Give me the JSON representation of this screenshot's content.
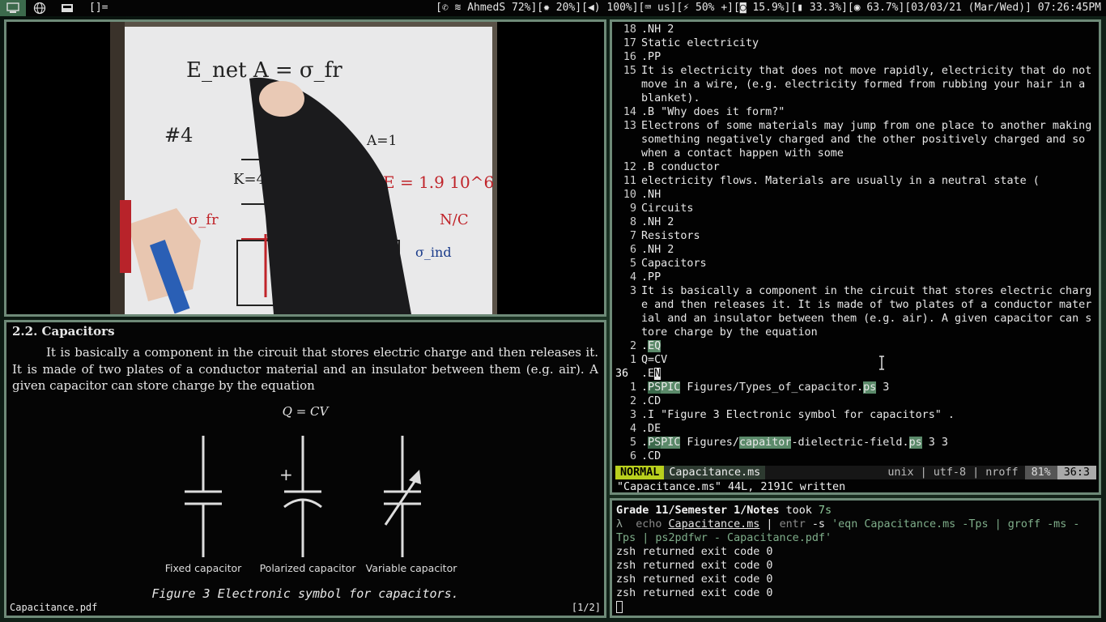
{
  "topbar": {
    "layout_symbol": "[]=",
    "status": {
      "wifi_name": "AhmedS",
      "wifi_strength": "72%",
      "brightness": "20%",
      "volume": "100%",
      "keyboard": "us",
      "battery": "50% +",
      "cpu": "15.9%",
      "memory": "33.3%",
      "disk": "63.7%",
      "date": "03/03/21 (Mar/Wed)",
      "time": "07:26:45PM"
    }
  },
  "pdf": {
    "heading": "2.2.  Capacitors",
    "paragraph": "It is basically a component in the circuit that stores electric charge and then releases it. It is made of two plates of a conductor material and an insulator between them (e.g. air). A given capacitor can store charge by the equation",
    "equation": "Q = CV",
    "figure_labels": [
      "Fixed capacitor",
      "Polarized capacitor",
      "Variable capacitor"
    ],
    "plus_sign": "+",
    "caption": "Figure 3 Electronic symbol for capacitors.",
    "footer_file": "Capacitance.pdf",
    "footer_page": "[1/2]"
  },
  "video": {
    "whiteboard_text": [
      "E_net A = σ_fr",
      "#4",
      "A=1",
      "K=4.5",
      "E = 1.9 10^6",
      "N/C",
      "σ_fr",
      "σ_ind"
    ]
  },
  "editor": {
    "lines": [
      {
        "n": "18",
        "t": ".NH 2"
      },
      {
        "n": "17",
        "t": "Static electricity"
      },
      {
        "n": "16",
        "t": ".PP"
      },
      {
        "n": "15",
        "t": "It is electricity that does not move rapidly, electricity that do not move in a wire, (e.g. electricity formed from rubbing your hair in a blanket)."
      },
      {
        "n": "14",
        "t": ".B \"Why does it form?\""
      },
      {
        "n": "13",
        "t": "Electrons of some materials may jump from one place to another making something negatively charged and the other positively charged and so when a contact happen with some"
      },
      {
        "n": "12",
        "t": ".B conductor"
      },
      {
        "n": "11",
        "t": "electricity flows. Materials are usually in a neutral state ("
      },
      {
        "n": "10",
        "t": ".NH"
      },
      {
        "n": "9",
        "t": "Circuits"
      },
      {
        "n": "8",
        "t": ".NH 2"
      },
      {
        "n": "7",
        "t": "Resistors"
      },
      {
        "n": "6",
        "t": ".NH 2"
      },
      {
        "n": "5",
        "t": "Capacitors"
      },
      {
        "n": "4",
        "t": ".PP"
      },
      {
        "n": "3",
        "t": "It is basically a component in the circuit that stores electric charge and then releases it. It is made of two plates of a conductor material and an insulator between them (e.g. air). A given capacitor can store charge by the equation"
      },
      {
        "n": "2",
        "t": ".EQ"
      },
      {
        "n": "1",
        "t": "Q=CV"
      },
      {
        "n": "36",
        "t": ".EN"
      },
      {
        "n": "1",
        "t": ".PSPIC Figures/Types_of_capacitor.ps 3"
      },
      {
        "n": "2",
        "t": ".CD"
      },
      {
        "n": "3",
        "t": ".I \"Figure 3 Electronic symbol for capacitors\" ."
      },
      {
        "n": "4",
        "t": ".DE"
      },
      {
        "n": "5",
        "t": ".PSPIC Figures/capaitor-dielectric-field.ps 3 3"
      },
      {
        "n": "6",
        "t": ".CD"
      }
    ],
    "parts": {
      "eq_dot": ".",
      "eq_word": "EQ",
      "en_dot": ".E",
      "en_cursor": "N",
      "ps": "PS",
      "pic": "PIC",
      "l19_mid": " Figures/Types_of_capacitor.",
      "l19_ext": "ps",
      "l19_end": " 3",
      "l23_mid": " Figures/",
      "l23_word": "capaitor",
      "l23_mid2": "-dielectric-field.",
      "l23_ext": "ps",
      "l23_end": " 3 3"
    },
    "statusline": {
      "mode": "NORMAL",
      "file": "Capacitance.ms",
      "info": "unix | utf-8 | nroff",
      "percent": "81%",
      "position": "36:3"
    },
    "message": "\"Capacitance.ms\" 44L, 2191C written"
  },
  "terminal": {
    "dir": "Grade 11/Semester 1/Notes",
    "took_label": " took ",
    "took_time": "7s",
    "prompt": "λ",
    "cmd_echo": "echo",
    "cmd_file": "Capacitance.ms",
    "cmd_pipe": " | ",
    "cmd_entr": "entr",
    "cmd_flag": " -s ",
    "cmd_string": "'eqn Capacitance.ms -Tps | groff -ms -Tps | ps2pdfwr - Capacitance.pdf'",
    "outputs": [
      "zsh returned exit code 0",
      "zsh returned exit code 0",
      "zsh returned exit code 0",
      "zsh returned exit code 0"
    ]
  }
}
